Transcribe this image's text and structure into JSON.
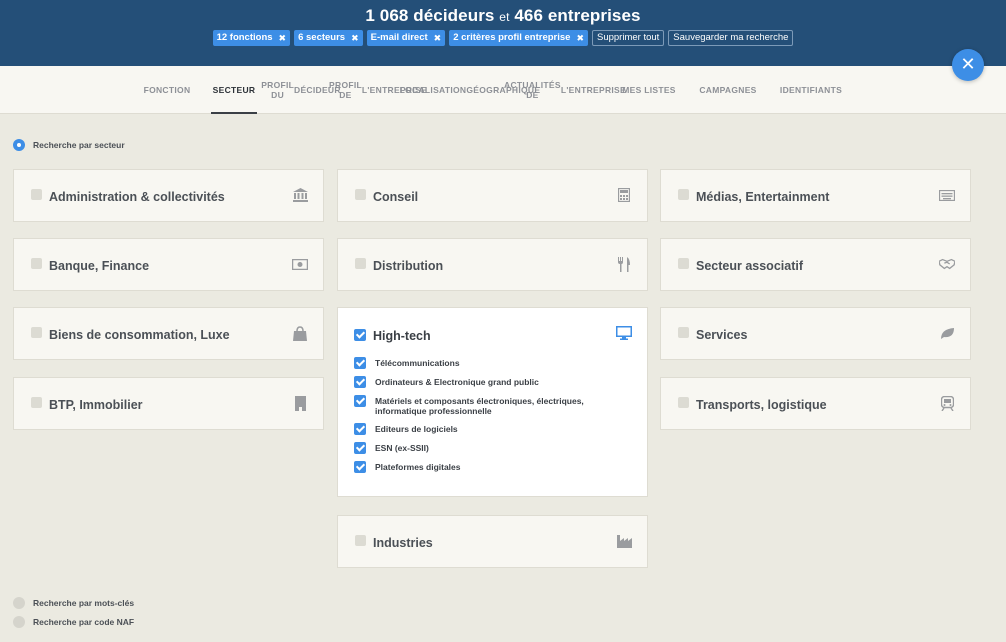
{
  "header": {
    "count_decideurs": "1 068 décideurs",
    "et": "et",
    "count_entreprises": "466 entreprises",
    "chips": [
      "12 fonctions",
      "6 secteurs",
      "E-mail direct",
      "2 critères profil entreprise"
    ],
    "chip_remove_icon": "✖",
    "clear_all": "Supprimer tout",
    "save_search": "Sauvegarder ma recherche"
  },
  "close_button": "✕",
  "tabs": [
    {
      "label": "FONCTION"
    },
    {
      "label": "SECTEUR",
      "active": true
    },
    {
      "label": "PROFIL DU DÉCIDEUR"
    },
    {
      "label": "PROFIL DE L'ENTREPRISE"
    },
    {
      "label": "LOCALISATION GÉOGRAPHIQUE"
    },
    {
      "label": "ACTUALITÉS DE L'ENTREPRISE"
    },
    {
      "label": "MES LISTES"
    },
    {
      "label": "CAMPAGNES"
    },
    {
      "label": "IDENTIFIANTS"
    }
  ],
  "search_modes": {
    "by_sector": "Recherche par secteur",
    "by_keywords": "Recherche par mots-clés",
    "by_naf": "Recherche par code NAF"
  },
  "sectors": {
    "administration": {
      "label": "Administration & collectivités",
      "icon": "bank-icon"
    },
    "banque": {
      "label": "Banque, Finance",
      "icon": "banknote-icon"
    },
    "biens": {
      "label": "Biens de consommation, Luxe",
      "icon": "shopping-bag-icon"
    },
    "btp": {
      "label": "BTP, Immobilier",
      "icon": "building-icon"
    },
    "conseil": {
      "label": "Conseil",
      "icon": "calculator-icon"
    },
    "distribution": {
      "label": "Distribution",
      "icon": "cutlery-icon"
    },
    "hightech": {
      "label": "High-tech",
      "icon": "monitor-icon",
      "checked": true,
      "subsectors": [
        "Télécommunications",
        "Ordinateurs & Electronique grand public",
        "Matériels et composants électroniques, électriques, informatique professionnelle",
        "Editeurs de logiciels",
        "ESN (ex-SSII)",
        "Plateformes digitales"
      ]
    },
    "industries": {
      "label": "Industries",
      "icon": "factory-icon"
    },
    "medias": {
      "label": "Médias, Entertainment",
      "icon": "keyboard-icon"
    },
    "associatif": {
      "label": "Secteur associatif",
      "icon": "handshake-icon"
    },
    "services": {
      "label": "Services",
      "icon": "leaf-icon"
    },
    "transports": {
      "label": "Transports, logistique",
      "icon": "train-icon"
    }
  },
  "colors": {
    "header_bg": "#244f78",
    "accent": "#3d8ee6",
    "page_bg": "#ebeae1",
    "card_bg": "#f8f7f2"
  }
}
